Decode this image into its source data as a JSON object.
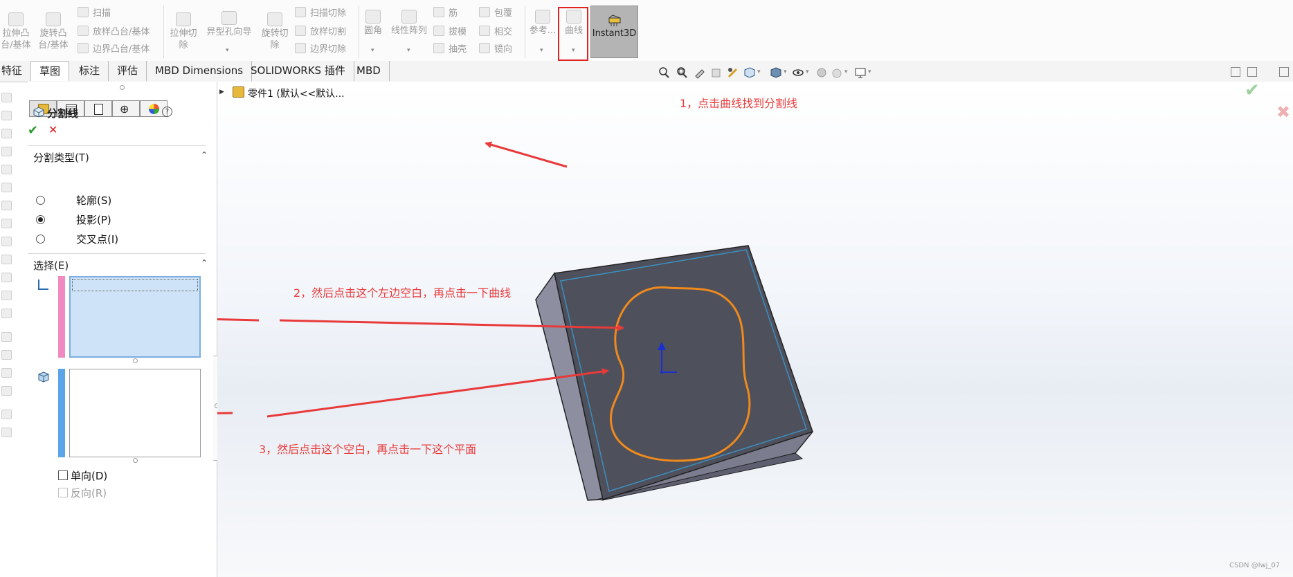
{
  "ribbon": {
    "extrude_boss": "拉伸凸台/基体",
    "revolve_boss": "旋转凸台/基体",
    "sweep": "扫描",
    "loft_boss": "放样凸台/基体",
    "boundary_boss": "边界凸台/基体",
    "extrude_cut": "拉伸切除",
    "hole_wizard": "异型孔向导",
    "revolve_cut": "旋转切除",
    "sweep_cut": "扫描切除",
    "loft_cut": "放样切割",
    "boundary_cut": "边界切除",
    "fillet": "圆角",
    "linear_pattern": "线性阵列",
    "rib": "筋",
    "draft": "拔模",
    "shell": "抽壳",
    "wrap": "包覆",
    "intersect": "相交",
    "mirror": "镜向",
    "reference": "参考...",
    "curves": "曲线",
    "instant3d": "Instant3D"
  },
  "tabs": [
    "特征",
    "草图",
    "标注",
    "评估",
    "MBD Dimensions",
    "SOLIDWORKS 插件",
    "MBD"
  ],
  "tree": {
    "part": "零件1 (默认<<默认..."
  },
  "pm": {
    "title": "分割线",
    "split_type": {
      "label": "分割类型(T)",
      "options": [
        "轮廓(S)",
        "投影(P)",
        "交叉点(I)"
      ],
      "selected": "投影(P)"
    },
    "selection": {
      "label": "选择(E)"
    },
    "single_direction": "单向(D)",
    "reverse_direction": "反向(R)"
  },
  "annotations": {
    "note1": "1，点击曲线找到分割线",
    "note2": "2，然后点击这个左边空白，再点击一下曲线",
    "note3": "3，然后点击这个空白，再点击一下这个平面"
  },
  "watermark": "CSDN @lwj_07",
  "colors": {
    "annotation": "#e83a3a",
    "selection_list_active": "#cfe3f8",
    "curve": "#f08a1c",
    "face": "#4e505c",
    "side": "#7b7d8e"
  }
}
